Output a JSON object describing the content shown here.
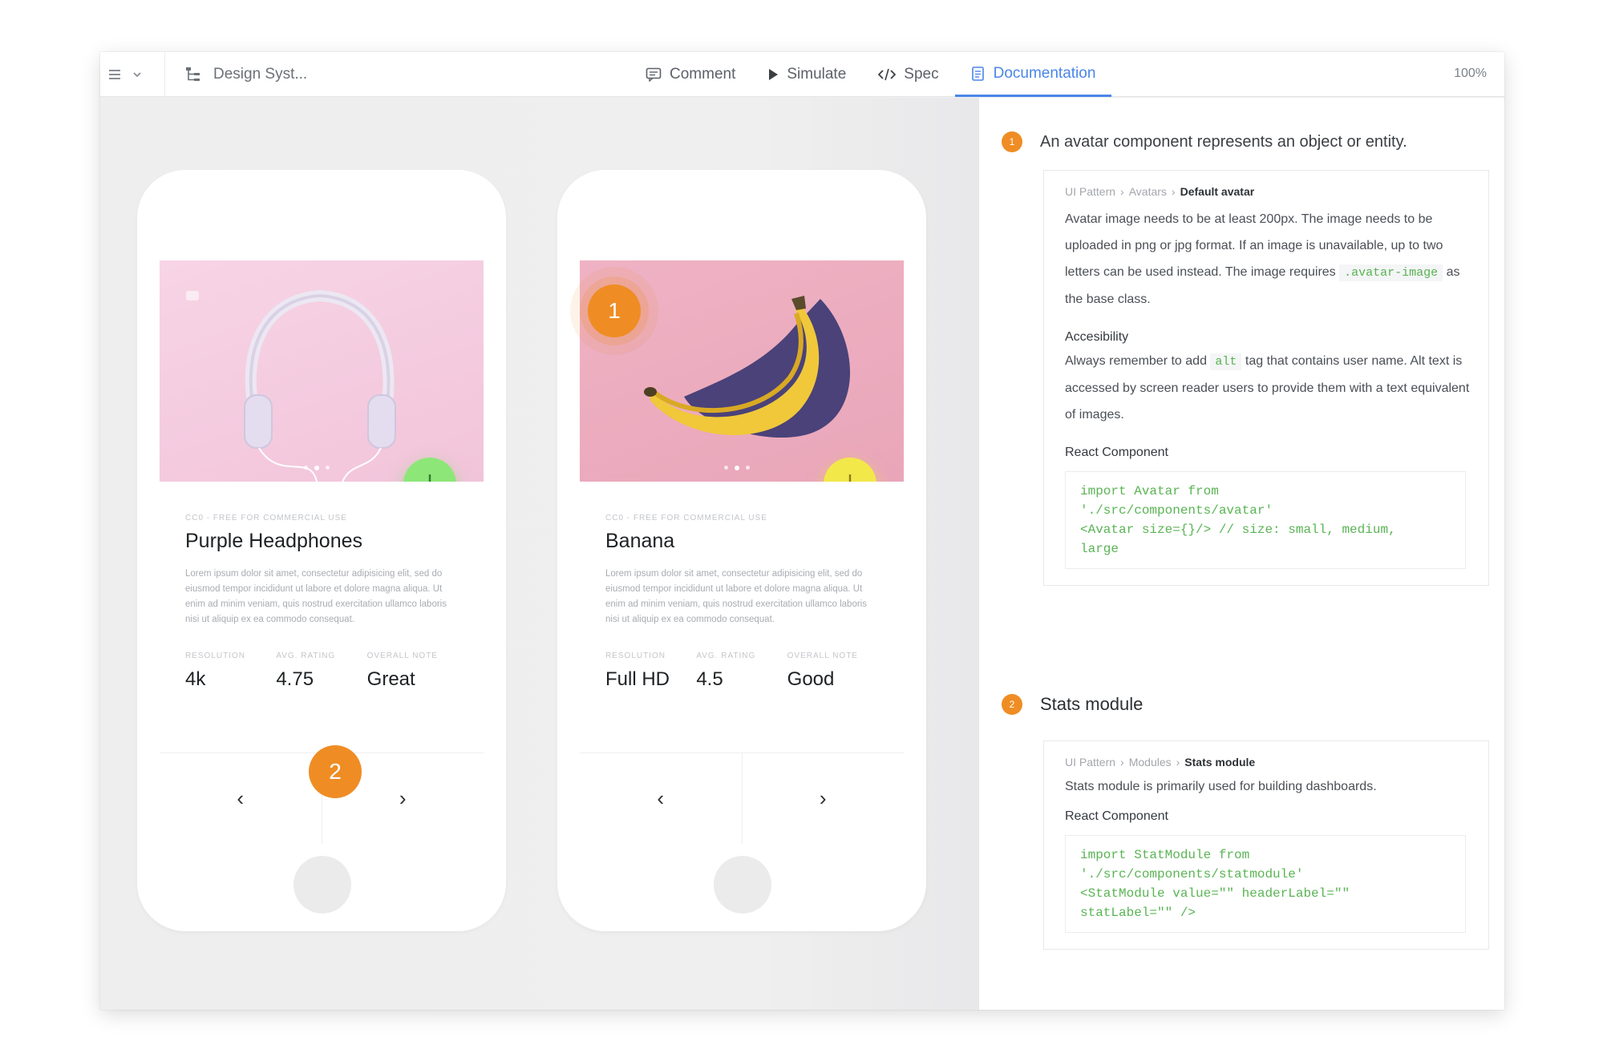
{
  "toolbar": {
    "project_name": "Design Syst...",
    "modes": [
      {
        "label": "Comment"
      },
      {
        "label": "Simulate"
      },
      {
        "label": "Spec"
      },
      {
        "label": "Documentation"
      }
    ],
    "active_mode": "Documentation",
    "zoom": "100%"
  },
  "cards": [
    {
      "license": "CC0 - FREE FOR COMMERCIAL USE",
      "title": "Purple Headphones",
      "description": "Lorem ipsum dolor sit amet, consectetur adipisicing elit, sed do eiusmod tempor incididunt ut labore et dolore magna aliqua. Ut enim ad minim veniam, quis nostrud exercitation ullamco laboris nisi ut aliquip ex ea commodo consequat.",
      "stats": [
        {
          "label": "RESOLUTION",
          "value": "4k"
        },
        {
          "label": "AVG. RATING",
          "value": "4.75"
        },
        {
          "label": "OVERALL NOTE",
          "value": "Great"
        }
      ],
      "download_color": "#8de678"
    },
    {
      "license": "CC0 - FREE FOR COMMERCIAL USE",
      "title": "Banana",
      "description": "Lorem ipsum dolor sit amet, consectetur adipisicing elit, sed do eiusmod tempor incididunt ut labore et dolore magna aliqua. Ut enim ad minim veniam, quis nostrud exercitation ullamco laboris nisi ut aliquip ex ea commodo consequat.",
      "stats": [
        {
          "label": "RESOLUTION",
          "value": "Full HD"
        },
        {
          "label": "AVG. RATING",
          "value": "4.5"
        },
        {
          "label": "OVERALL NOTE",
          "value": "Good"
        }
      ],
      "download_color": "#f2e84a"
    }
  ],
  "card_nav": {
    "prev": "‹",
    "next": "›"
  },
  "markers": [
    "1",
    "2"
  ],
  "documentation": {
    "sections": [
      {
        "number": "1",
        "heading": "An avatar component represents an object or entity.",
        "breadcrumb": [
          "UI Pattern",
          "Avatars",
          "Default avatar"
        ],
        "body_before_code": "Avatar image needs to be at least 200px. The image needs to be uploaded in png or jpg format. If an image is unavailable, up to two letters can be used instead. The image requires",
        "inline_code": ".avatar-image",
        "body_after_code": "as  the base class.",
        "accessibility_title": "Accesibility",
        "accessibility_before": "Always remember to add",
        "accessibility_code": "alt",
        "accessibility_after": "tag that contains user name. Alt text is accessed by screen reader users to provide them with a text equivalent  of images.",
        "react_title": "React Component",
        "code": "import Avatar from\n'./src/components/avatar'\n<Avatar size={}/> // size: small, medium,\nlarge"
      },
      {
        "number": "2",
        "heading": "Stats module",
        "breadcrumb": [
          "UI Pattern",
          "Modules",
          "Stats module"
        ],
        "body": "Stats module is primarily used for building dashboards.",
        "react_title": "React Component",
        "code": "import StatModule from\n'./src/components/statmodule'\n<StatModule value=\"\" headerLabel=\"\"\nstatLabel=\"\" />"
      }
    ]
  },
  "colors": {
    "accent": "#4a86e8",
    "marker": "#ef8d24",
    "code": "#57b352"
  }
}
